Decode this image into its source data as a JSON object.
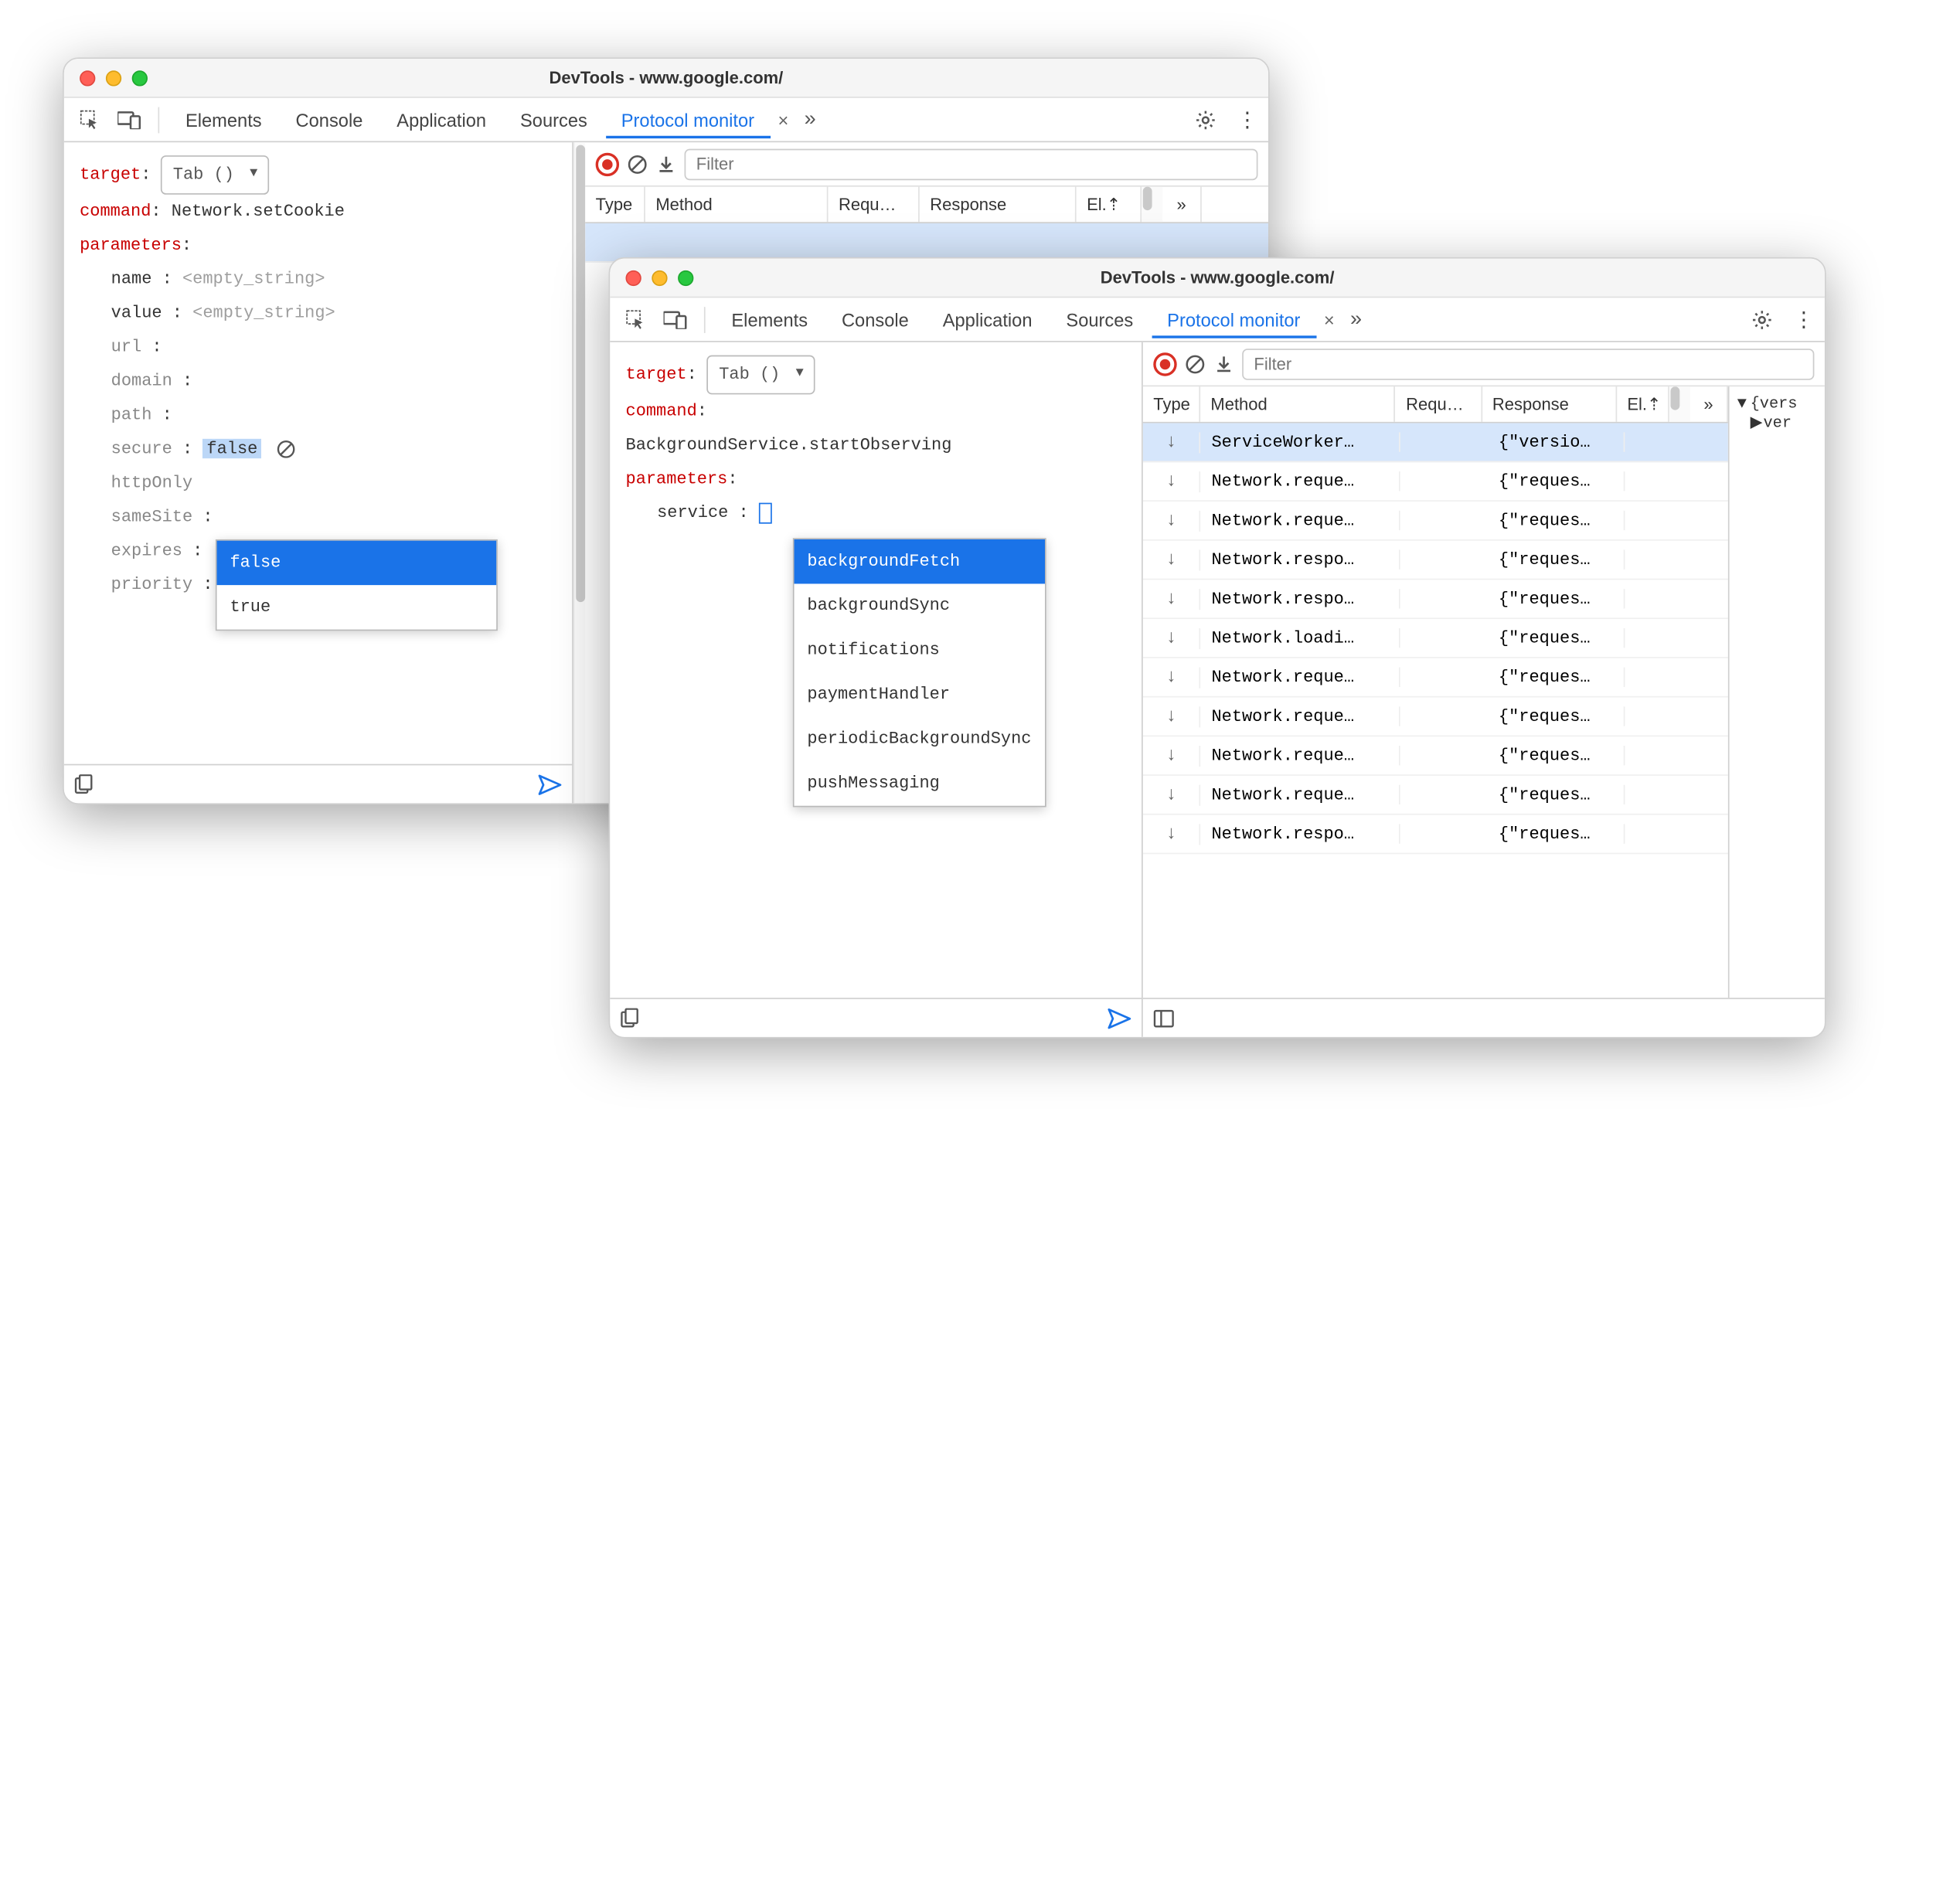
{
  "windows": {
    "w1": {
      "title": "DevTools - www.google.com/",
      "tabs": [
        "Elements",
        "Console",
        "Application",
        "Sources",
        "Protocol monitor"
      ],
      "active_tab": "Protocol monitor",
      "target_label": "target",
      "target_value": "Tab ()",
      "command_label": "command",
      "command_value": "Network.setCookie",
      "parameters_label": "parameters",
      "params": {
        "name": {
          "k": "name",
          "ph": "<empty_string>"
        },
        "value": {
          "k": "value",
          "ph": "<empty_string>"
        },
        "url": {
          "k": "url"
        },
        "domain": {
          "k": "domain"
        },
        "path": {
          "k": "path"
        },
        "secure": {
          "k": "secure",
          "v": "false"
        },
        "httpOnly": {
          "k": "httpOnly"
        },
        "sameSite": {
          "k": "sameSite"
        },
        "expires": {
          "k": "expires"
        },
        "priority": {
          "k": "priority"
        }
      },
      "secure_opts": [
        "false",
        "true"
      ],
      "filter_placeholder": "Filter",
      "cols": {
        "type": "Type",
        "method": "Method",
        "req": "Requ…",
        "resp": "Response",
        "el": "El.⇡"
      }
    },
    "w2": {
      "title": "DevTools - www.google.com/",
      "tabs": [
        "Elements",
        "Console",
        "Application",
        "Sources",
        "Protocol monitor"
      ],
      "active_tab": "Protocol monitor",
      "target_label": "target",
      "target_value": "Tab ()",
      "command_label": "command",
      "command_value": "BackgroundService.startObserving",
      "parameters_label": "parameters",
      "service_key": "service",
      "service_opts": [
        "backgroundFetch",
        "backgroundSync",
        "notifications",
        "paymentHandler",
        "periodicBackgroundSync",
        "pushMessaging"
      ],
      "filter_placeholder": "Filter",
      "cols": {
        "type": "Type",
        "method": "Method",
        "req": "Requ…",
        "resp": "Response",
        "el": "El.⇡"
      },
      "rows": [
        {
          "method": "ServiceWorker…",
          "resp": "{\"versio…",
          "sel": true
        },
        {
          "method": "Network.reque…",
          "resp": "{\"reques…"
        },
        {
          "method": "Network.reque…",
          "resp": "{\"reques…"
        },
        {
          "method": "Network.respo…",
          "resp": "{\"reques…"
        },
        {
          "method": "Network.respo…",
          "resp": "{\"reques…"
        },
        {
          "method": "Network.loadi…",
          "resp": "{\"reques…"
        },
        {
          "method": "Network.reque…",
          "resp": "{\"reques…"
        },
        {
          "method": "Network.reque…",
          "resp": "{\"reques…"
        },
        {
          "method": "Network.reque…",
          "resp": "{\"reques…"
        },
        {
          "method": "Network.reque…",
          "resp": "{\"reques…"
        },
        {
          "method": "Network.respo…",
          "resp": "{\"reques…"
        }
      ],
      "detail_root": "{vers",
      "detail_child": "ver"
    }
  }
}
